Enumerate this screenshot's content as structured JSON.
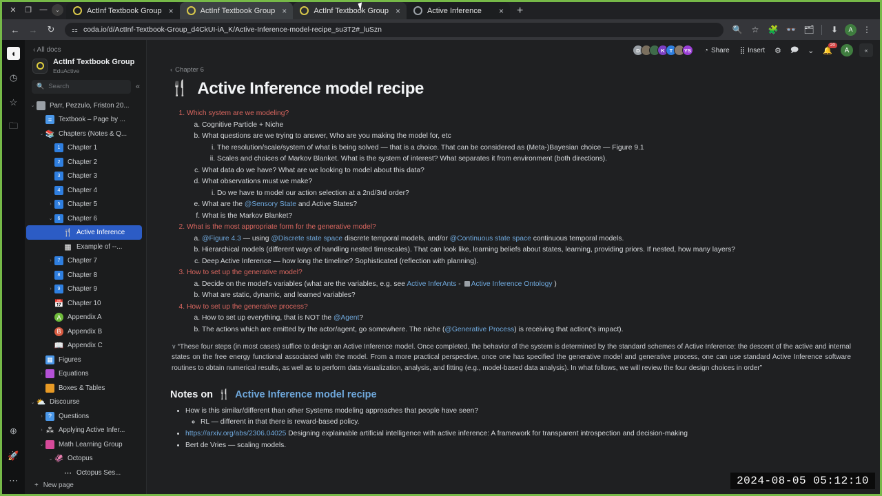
{
  "browser": {
    "window_controls": [
      "close-x",
      "restore",
      "minimize",
      "chevron"
    ],
    "tabs": [
      {
        "title": "ActInf Textbook Group",
        "favicon": "coda-ring-icon",
        "state": "inactive",
        "close": "×"
      },
      {
        "title": "ActInf Textbook Group",
        "favicon": "coda-ring-icon",
        "state": "active",
        "close": "×"
      },
      {
        "title": "ActInf Textbook Group",
        "favicon": "coda-ring-icon",
        "state": "inactive",
        "close": "×"
      },
      {
        "title": "Active Inference",
        "favicon": "globe-icon",
        "state": "inactive",
        "close": "×"
      }
    ],
    "new_tab_label": "+",
    "nav": {
      "back": "←",
      "forward": "→",
      "reload": "↻"
    },
    "url": "coda.io/d/ActInf-Textbook-Group_d4CkUI-iA_K/Active-Inference-model-recipe_su3T2#_luSzn",
    "site_icon": "tune-icon",
    "right_icons": [
      "zoom-icon",
      "bookmark-star-icon",
      "extension-icon",
      "glasses-icon",
      "tab-group-icon",
      "download-icon"
    ],
    "profile_initial": "A",
    "menu": "⋮"
  },
  "rail": {
    "logo": "coda-logo-icon",
    "items": [
      "clock-icon",
      "star-icon",
      "folder-icon"
    ],
    "bottom_items": [
      "plus-circle-icon",
      "rocket-icon",
      "more-dots-icon"
    ]
  },
  "sidebar": {
    "all_docs": "‹ All docs",
    "doc_title": "ActInf Textbook Group",
    "doc_subtitle": "EduActive",
    "search_placeholder": "Search",
    "collapse_icon": "«",
    "new_page": "New page",
    "tree": [
      {
        "label": "Parr, Pezzulo, Friston 20...",
        "indent": 0,
        "twist": "⌄",
        "icon": "book-icon",
        "iconclass": "sq-grey",
        "glyph": ""
      },
      {
        "label": "Textbook – Page by ...",
        "indent": 1,
        "twist": "",
        "icon": "list-icon",
        "iconclass": "sq-lblue",
        "glyph": "≡"
      },
      {
        "label": "Chapters (Notes & Q...",
        "indent": 1,
        "twist": "⌄",
        "icon": "books-icon",
        "iconclass": "sq-plain",
        "glyph": "📚"
      },
      {
        "label": "Chapter 1",
        "indent": 2,
        "twist": "",
        "icon": "chapter-icon",
        "iconclass": "sq-blue",
        "glyph": "1"
      },
      {
        "label": "Chapter 2",
        "indent": 2,
        "twist": "",
        "icon": "chapter-icon",
        "iconclass": "sq-blue",
        "glyph": "2"
      },
      {
        "label": "Chapter 3",
        "indent": 2,
        "twist": "",
        "icon": "chapter-icon",
        "iconclass": "sq-blue",
        "glyph": "3"
      },
      {
        "label": "Chapter 4",
        "indent": 2,
        "twist": "",
        "icon": "chapter-icon",
        "iconclass": "sq-blue",
        "glyph": "4"
      },
      {
        "label": "Chapter 5",
        "indent": 2,
        "twist": "›",
        "icon": "chapter-icon",
        "iconclass": "sq-blue",
        "glyph": "5"
      },
      {
        "label": "Chapter 6",
        "indent": 2,
        "twist": "⌄",
        "icon": "chapter-icon",
        "iconclass": "sq-blue",
        "glyph": "6"
      },
      {
        "label": "Active Inference",
        "indent": 3,
        "twist": "",
        "icon": "fork-knife-icon",
        "iconclass": "sq-plain",
        "glyph": "🍴",
        "selected": true
      },
      {
        "label": "Example of --...",
        "indent": 3,
        "twist": "",
        "icon": "table-icon",
        "iconclass": "sq-plain",
        "glyph": "▦"
      },
      {
        "label": "Chapter 7",
        "indent": 2,
        "twist": "›",
        "icon": "chapter-icon",
        "iconclass": "sq-blue",
        "glyph": "7"
      },
      {
        "label": "Chapter 8",
        "indent": 2,
        "twist": "",
        "icon": "chapter-icon",
        "iconclass": "sq-blue",
        "glyph": "8"
      },
      {
        "label": "Chapter 9",
        "indent": 2,
        "twist": "›",
        "icon": "chapter-icon",
        "iconclass": "sq-blue",
        "glyph": "9"
      },
      {
        "label": "Chapter 10",
        "indent": 2,
        "twist": "",
        "icon": "calendar-icon",
        "iconclass": "sq-plain",
        "glyph": "📅"
      },
      {
        "label": "Appendix A",
        "indent": 2,
        "twist": "",
        "icon": "circle-green-icon",
        "iconclass": "sq-green",
        "glyph": "A"
      },
      {
        "label": "Appendix B",
        "indent": 2,
        "twist": "",
        "icon": "circle-red-icon",
        "iconclass": "sq-red",
        "glyph": "B"
      },
      {
        "label": "Appendix C",
        "indent": 2,
        "twist": "",
        "icon": "book-grey-icon",
        "iconclass": "sq-plain",
        "glyph": "📖"
      },
      {
        "label": "Figures",
        "indent": 1,
        "twist": "",
        "icon": "grid-icon",
        "iconclass": "sq-lblue",
        "glyph": "▦"
      },
      {
        "label": "Equations",
        "indent": 1,
        "twist": "›",
        "icon": "equation-icon",
        "iconclass": "sq-purple",
        "glyph": ""
      },
      {
        "label": "Boxes & Tables",
        "indent": 1,
        "twist": "",
        "icon": "boxes-icon",
        "iconclass": "sq-orange",
        "glyph": ""
      },
      {
        "label": "Discourse",
        "indent": 0,
        "twist": "⌄",
        "icon": "cloud-icon",
        "iconclass": "sq-plain",
        "glyph": "⛅"
      },
      {
        "label": "Questions",
        "indent": 1,
        "twist": "›",
        "icon": "question-icon",
        "iconclass": "sq-lblue",
        "glyph": "?"
      },
      {
        "label": "Applying Active Infer...",
        "indent": 1,
        "twist": "›",
        "icon": "network-icon",
        "iconclass": "sq-plain",
        "glyph": "⁂"
      },
      {
        "label": "Math Learning Group",
        "indent": 1,
        "twist": "⌄",
        "icon": "squares-icon",
        "iconclass": "sq-pink",
        "glyph": ""
      },
      {
        "label": "Octopus",
        "indent": 2,
        "twist": "⌄",
        "icon": "octopus-icon",
        "iconclass": "sq-plain",
        "glyph": "🦑"
      },
      {
        "label": "Octopus Ses...",
        "indent": 3,
        "twist": "",
        "icon": "dots-icon",
        "iconclass": "sq-plain",
        "glyph": "⋯"
      }
    ]
  },
  "topbar": {
    "avatars": [
      {
        "initial": "D",
        "color": "#9aa0a6"
      },
      {
        "initial": "",
        "color": "#7a6f5e"
      },
      {
        "initial": "",
        "color": "#3f6b4a"
      },
      {
        "initial": "K",
        "color": "#7c3fc4"
      },
      {
        "initial": "T",
        "color": "#2f7fe0"
      },
      {
        "initial": "",
        "color": "#8a7a6a"
      },
      {
        "initial": "YS",
        "color": "#9b3fd6"
      }
    ],
    "share_label": "Share",
    "share_icon": "share-icon",
    "insert_label": "Insert",
    "insert_icon": "grid-insert-icon",
    "settings_icon": "gear-icon",
    "comment_icon": "comment-icon",
    "chevron_icon": "chevron-down-icon",
    "bell_icon": "bell-icon",
    "bell_badge": "20",
    "profile_initial": "A",
    "collapse_right_icon": "«"
  },
  "document": {
    "breadcrumb": "Chapter 6",
    "breadcrumb_back_icon": "‹",
    "title_emoji": "🍴",
    "title": "Active Inference model recipe",
    "outline": [
      {
        "num": "1.",
        "text": "Which system are we modeling?",
        "children": [
          {
            "text": "Cognitive Particle + Niche"
          },
          {
            "text": "What questions are we trying to answer, Who are you making the model for, etc",
            "children": [
              {
                "text": "The resolution/scale/system of what is being solved — that is a choice. That can be considered as (Meta-)Bayesian choice — Figure 9.1"
              },
              {
                "text": "Scales and choices of Markov Blanket. What is the system of interest? What separates it from environment (both directions)."
              }
            ]
          },
          {
            "text": "What data do we have? What are we looking to model about this data?"
          },
          {
            "text": "What observations must we make?",
            "children": [
              {
                "text": "Do we have to model our action selection at a 2nd/3rd order?"
              }
            ]
          },
          {
            "html": "What are the <span class='ref-at'>@Sensory State</span> and Active States?"
          },
          {
            "text": "What is the Markov Blanket?"
          }
        ]
      },
      {
        "num": "2.",
        "text": "What is the most appropriate form for the generative model?",
        "children": [
          {
            "html": "<span class='ref-at'>@Figure 4.3</span> — using <span class='ref-at'>@Discrete state space</span> discrete temporal models, and/or <span class='ref-at'>@Continuous state space</span> continuous temporal models."
          },
          {
            "text": "Hierarchical models (different ways of handling nested timescales). That can look like, learning beliefs about states, learning, providing priors. If nested, how many layers?"
          },
          {
            "text": "Deep Active Inference — how long the timeline? Sophisticated (reflection with planning)."
          }
        ]
      },
      {
        "num": "3.",
        "text": "How to set up the generative model?",
        "children": [
          {
            "html": "Decide on the model's variables (what are the variables, e.g. see <span class='lnk'>Active InferAnts</span> - <span class='ont-ic'></span><span class='lnk'>Active Inference Ontology</span> )"
          },
          {
            "text": "What are static, dynamic, and learned variables?"
          }
        ]
      },
      {
        "num": "4.",
        "text": "How to set up the generative process?",
        "children": [
          {
            "html": "How to set up everything, that is NOT the <span class='ref-at'>@Agent</span>?"
          },
          {
            "html": "The actions which are emitted by the actor/agent, go somewhere. The niche (<span class='ref-at'>@Generative Process</span>) is receiving that action('s impact)."
          }
        ]
      }
    ],
    "quote_caret": "∨",
    "quote": "“These four steps (in most cases) suffice to design an Active Inference model. Once completed, the behavior of the system is determined by the standard schemes of Active Inference: the descent of the active and internal states on the free energy functional associated with the model. From a more practical perspective, once one has specified the generative model and generative process, one can use standard Active Inference software routines to obtain numerical results, as well as to perform data visualization, analysis, and fitting (e.g., model-based data analysis). In what follows, we will review the four design choices in order”",
    "notes_heading_prefix": "Notes on",
    "notes_heading_emoji": "🍴",
    "notes_heading_link": "Active Inference model recipe",
    "notes": [
      {
        "text": "How is this similar/different than other Systems modeling approaches that people have seen?",
        "children": [
          {
            "text": "RL — different in that there is reward-based policy."
          }
        ]
      },
      {
        "html": "<span class='lnk'>https://arxiv.org/abs/2306.04025</span> Designing explainable artificial intelligence with active inference: A framework for transparent introspection and decision-making"
      },
      {
        "text": "Bert de Vries — scaling models."
      }
    ]
  },
  "overlay": {
    "timestamp": "2024-08-05 05:12:10"
  },
  "colors": {
    "accent_green": "#76b948",
    "heading_red": "#d9665f",
    "link_blue": "#6fa8dc",
    "selection_blue": "#2c5cc5"
  }
}
